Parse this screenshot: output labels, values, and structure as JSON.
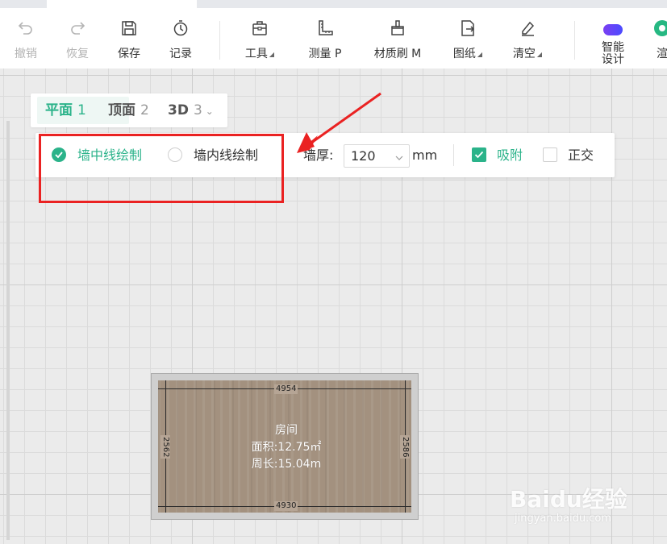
{
  "toolbar": {
    "items": [
      {
        "label": "撤销",
        "icon": "undo-icon",
        "disabled": true
      },
      {
        "label": "恢复",
        "icon": "redo-icon",
        "disabled": true
      },
      {
        "label": "保存",
        "icon": "save-icon"
      },
      {
        "label": "记录",
        "icon": "history-icon"
      },
      {
        "label": "工具",
        "icon": "toolbox-icon"
      },
      {
        "label": "测量 P",
        "icon": "ruler-icon"
      },
      {
        "label": "材质刷 M",
        "icon": "brush-icon"
      },
      {
        "label": "图纸",
        "icon": "drawing-import-icon"
      },
      {
        "label": "清空",
        "icon": "eraser-icon"
      },
      {
        "label": "智能设计",
        "label_line1": "智能",
        "label_line2": "设计",
        "icon": "ai-design-icon"
      },
      {
        "label": "渲",
        "icon": "render-icon"
      }
    ]
  },
  "view_tabs": [
    {
      "label": "平面",
      "num": "1",
      "active": true
    },
    {
      "label": "顶面",
      "num": "2"
    },
    {
      "label": "3D",
      "num": "3"
    }
  ],
  "options": {
    "center_line": "墙中线绘制",
    "inner_line": "墙内线绘制",
    "thickness_label": "墙厚:",
    "thickness_value": "120",
    "thickness_unit": "mm",
    "snap": "吸附",
    "snap_checked": true,
    "ortho": "正交",
    "ortho_checked": false
  },
  "room": {
    "name": "房间",
    "area": "面积:12.75㎡",
    "perimeter": "周长:15.04m",
    "dim_top": "4954",
    "dim_bottom": "4930",
    "dim_left": "2562",
    "dim_right": "2586"
  },
  "watermark": {
    "main": "Baidu经验",
    "sub": "jingyan.baidu.com"
  },
  "colors": {
    "accent": "#2bb38a",
    "annotation": "#ea2222"
  }
}
